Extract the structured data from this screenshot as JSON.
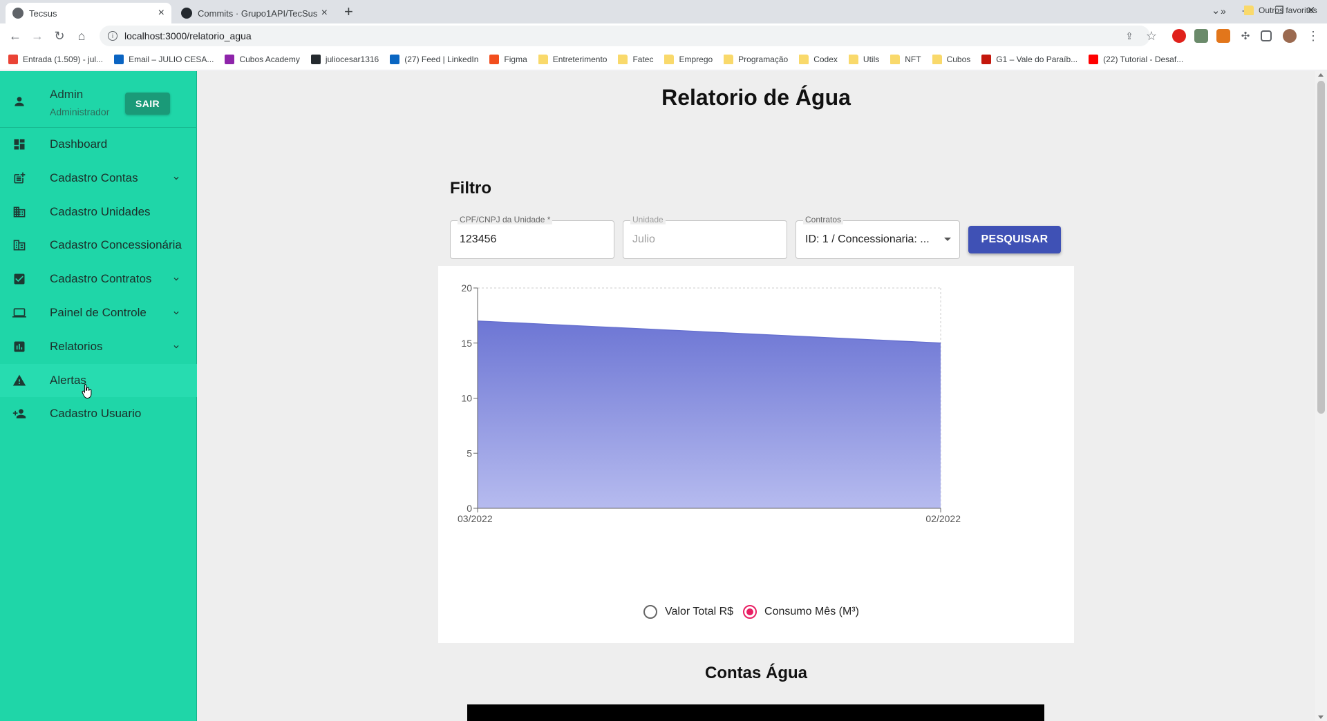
{
  "browser": {
    "tabs": [
      {
        "title": "Tecsus",
        "active": true,
        "favicon": "globe-icon"
      },
      {
        "title": "Commits · Grupo1API/TecSus",
        "active": false,
        "favicon": "github-icon"
      }
    ],
    "url": "localhost:3000/relatorio_agua",
    "bookmarks": [
      {
        "label": "Entrada (1.509) - jul...",
        "icon": "gmail-icon",
        "color": "#ea4335"
      },
      {
        "label": "Email – JULIO CESA...",
        "icon": "outlook-icon",
        "color": "#0a64c2"
      },
      {
        "label": "Cubos Academy",
        "icon": "cubos-icon",
        "color": "#8e24aa"
      },
      {
        "label": "juliocesar1316",
        "icon": "github-icon",
        "color": "#24292e"
      },
      {
        "label": "(27) Feed | LinkedIn",
        "icon": "linkedin-icon",
        "color": "#0a66c2"
      },
      {
        "label": "Figma",
        "icon": "figma-icon",
        "color": "#f24e1e"
      },
      {
        "label": "Entreterimento",
        "icon": "folder-icon",
        "color": "#f9d96b"
      },
      {
        "label": "Fatec",
        "icon": "folder-icon",
        "color": "#f9d96b"
      },
      {
        "label": "Emprego",
        "icon": "folder-icon",
        "color": "#f9d96b"
      },
      {
        "label": "Programação",
        "icon": "folder-icon",
        "color": "#f9d96b"
      },
      {
        "label": "Codex",
        "icon": "folder-icon",
        "color": "#f9d96b"
      },
      {
        "label": "Utils",
        "icon": "folder-icon",
        "color": "#f9d96b"
      },
      {
        "label": "NFT",
        "icon": "folder-icon",
        "color": "#f9d96b"
      },
      {
        "label": "Cubos",
        "icon": "folder-icon",
        "color": "#f9d96b"
      },
      {
        "label": "G1 – Vale do Paraíb...",
        "icon": "g1-icon",
        "color": "#c4170c"
      },
      {
        "label": "(22) Tutorial - Desaf...",
        "icon": "youtube-icon",
        "color": "#ff0000"
      }
    ],
    "more_bookmarks": "»",
    "other_bookmarks": "Outros favoritos"
  },
  "sidebar": {
    "user_name": "Admin",
    "user_role": "Administrador",
    "logout_label": "SAIR",
    "items": [
      {
        "label": "Dashboard",
        "icon": "dashboard-icon",
        "has_chevron": false
      },
      {
        "label": "Cadastro Contas",
        "icon": "post-add-icon",
        "has_chevron": true
      },
      {
        "label": "Cadastro Unidades",
        "icon": "domain-icon",
        "has_chevron": false
      },
      {
        "label": "Cadastro Concessionária",
        "icon": "business-icon",
        "has_chevron": false
      },
      {
        "label": "Cadastro Contratos",
        "icon": "checkbox-icon",
        "has_chevron": true
      },
      {
        "label": "Painel de Controle",
        "icon": "laptop-icon",
        "has_chevron": true
      },
      {
        "label": "Relatorios",
        "icon": "bar-chart-icon",
        "has_chevron": true
      },
      {
        "label": "Alertas",
        "icon": "warning-icon",
        "has_chevron": false
      },
      {
        "label": "Cadastro Usuario",
        "icon": "person-add-icon",
        "has_chevron": false
      }
    ],
    "hover_item": "Alertas"
  },
  "page": {
    "title": "Relatorio de Água",
    "filter_title": "Filtro",
    "fields": {
      "cpf": {
        "label": "CPF/CNPJ da Unidade *",
        "value": "123456"
      },
      "unit": {
        "label": "Unidade",
        "value": "Julio"
      },
      "contracts": {
        "label": "Contratos",
        "value": "ID: 1 / Concessionaria: ..."
      }
    },
    "search_label": "PESQUISAR",
    "radio_options": [
      {
        "label": "Valor Total R$",
        "checked": false
      },
      {
        "label": "Consumo Mês (M³)",
        "checked": true
      }
    ],
    "bills_title": "Contas Água"
  },
  "chart_data": {
    "type": "area",
    "x": [
      "03/2022",
      "02/2022"
    ],
    "series": [
      {
        "values": [
          17,
          15
        ]
      }
    ],
    "ylim": [
      0,
      20
    ],
    "yticks": [
      0,
      5,
      10,
      15,
      20
    ],
    "grid": true,
    "color": "#7b84d8",
    "title": "",
    "xlabel": "",
    "ylabel": ""
  },
  "colors": {
    "sidebar": "#1fd6a8",
    "logout": "#1a9a78",
    "primary": "#3f51b5",
    "radio_checked": "#e91e63"
  }
}
